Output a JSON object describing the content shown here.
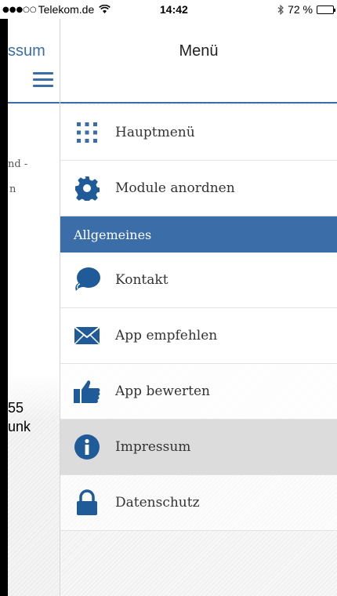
{
  "statusbar": {
    "carrier": "Telekom.de",
    "signal_dots": "●●●○○",
    "time": "14:42",
    "battery": "72 %"
  },
  "background_screen": {
    "title": "ssum",
    "text1": "nd -",
    "text2": "n",
    "big_line1": "55",
    "big_line2": "unk"
  },
  "menu": {
    "title": "Menü",
    "items": [
      {
        "label": "Hauptmenü",
        "icon": "grid-icon"
      },
      {
        "label": "Module anordnen",
        "icon": "gear-icon"
      }
    ],
    "section": "Allgemeines",
    "general_items": [
      {
        "label": "Kontakt",
        "icon": "speech-bubble-icon"
      },
      {
        "label": "App empfehlen",
        "icon": "envelope-icon"
      },
      {
        "label": "App bewerten",
        "icon": "thumbs-up-icon"
      },
      {
        "label": "Impressum",
        "icon": "info-icon",
        "active": true
      },
      {
        "label": "Datenschutz",
        "icon": "lock-icon"
      }
    ]
  },
  "colors": {
    "accent": "#3b6ea8",
    "active_row": "#dcdcdc"
  }
}
